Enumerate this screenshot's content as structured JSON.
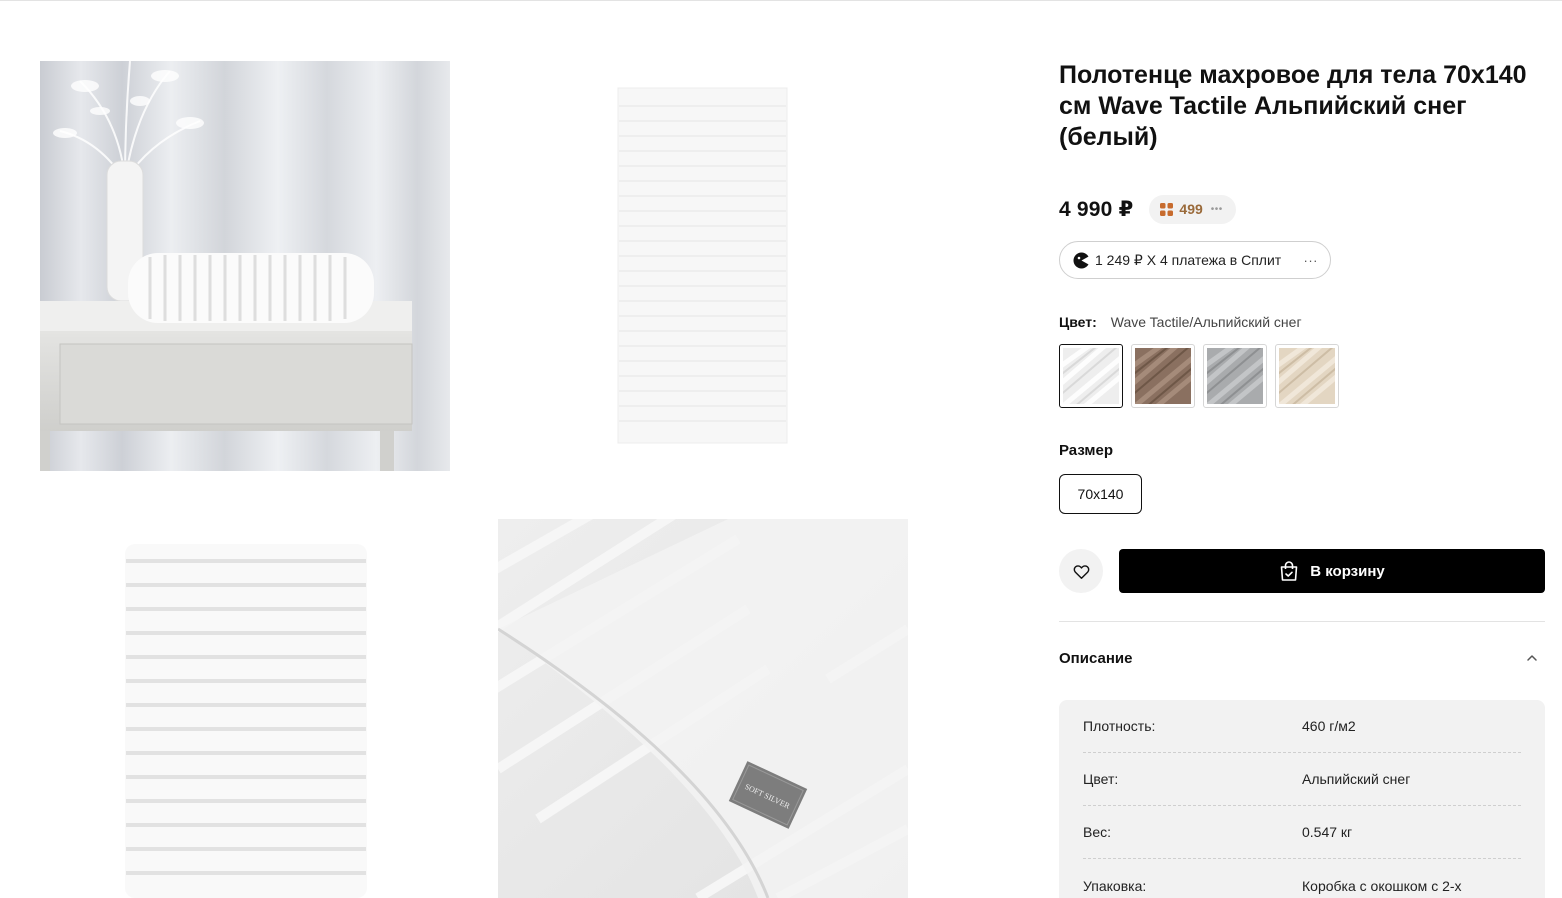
{
  "product": {
    "title": "Полотенце махровое для тела 70x140 см Wave Tactile Альпийский снег (белый)",
    "price": "4 990 ₽",
    "bonus": {
      "value": "499",
      "dots": "•••",
      "icon": "bonus-icon",
      "color": "#9a6a3a"
    },
    "split": {
      "text": "1 249 ₽ Х 4 платежа в Сплит",
      "dots": "···",
      "icon": "split-icon"
    }
  },
  "color": {
    "label": "Цвет:",
    "value": "Wave Tactile/Альпийский снег",
    "swatches": [
      {
        "name": "Альпийский снег",
        "hex": "#eeeeee",
        "selected": true
      },
      {
        "name": "brown",
        "hex": "#8a7060",
        "selected": false
      },
      {
        "name": "grey",
        "hex": "#a9abad",
        "selected": false
      },
      {
        "name": "beige",
        "hex": "#e3d6c2",
        "selected": false
      }
    ]
  },
  "size": {
    "label": "Размер",
    "options": [
      "70x140"
    ],
    "selected": "70x140"
  },
  "actions": {
    "cart_label": "В корзину",
    "favorite_icon": "heart-icon",
    "cart_icon": "bag-icon"
  },
  "description": {
    "title": "Описание",
    "expanded": true,
    "specs": [
      {
        "key": "Плотность:",
        "value": "460 г/м2"
      },
      {
        "key": "Цвет:",
        "value": "Альпийский снег"
      },
      {
        "key": "Вес:",
        "value": "0.547 кг"
      },
      {
        "key": "Упаковка:",
        "value": "Коробка с окошком с 2-х"
      }
    ]
  },
  "gallery": {
    "label_text": "SOFT SILVER",
    "images": [
      "towel-on-table-photo",
      "flat-towel-photo",
      "folded-towel-photo",
      "towel-closeup-photo"
    ]
  }
}
